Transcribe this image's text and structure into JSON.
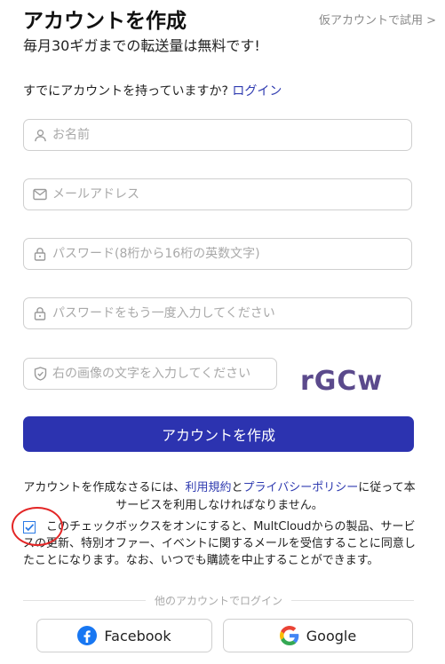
{
  "header": {
    "title": "アカウントを作成",
    "trial_link": "仮アカウントで試用 >",
    "subtitle": "毎月30ギガまでの転送量は無料です!"
  },
  "login_prompt": {
    "text": "すでにアカウントを持っていますか? ",
    "link": "ログイン"
  },
  "form": {
    "name_placeholder": "お名前",
    "email_placeholder": "メールアドレス",
    "password_placeholder": "パスワード(8桁から16桁の英数文字)",
    "confirm_placeholder": "パスワードをもう一度入力してください",
    "captcha_placeholder": "右の画像の文字を入力してください",
    "captcha_text": "rGCw",
    "submit_label": "アカウントを作成"
  },
  "terms": {
    "before": "アカウントを作成なさるには、",
    "link_terms": "利用規約",
    "and": "と",
    "link_privacy": "プライバシーポリシー",
    "after": "に従って本サービスを利用しなければなりません。"
  },
  "consent": {
    "checked": true,
    "text": "このチェックボックスをオンにすると、MultCloudからの製品、サービスの更新、特別オファー、イベントに関するメールを受信することに同意したことになります。なお、いつでも購読を中止することができます。"
  },
  "social": {
    "divider_label": "他のアカウントでログイン",
    "facebook_label": "Facebook",
    "google_label": "Google"
  },
  "colors": {
    "primary": "#2c33b0",
    "link": "#2f3bb0",
    "highlight_circle": "#e32626",
    "facebook": "#1877f2"
  }
}
